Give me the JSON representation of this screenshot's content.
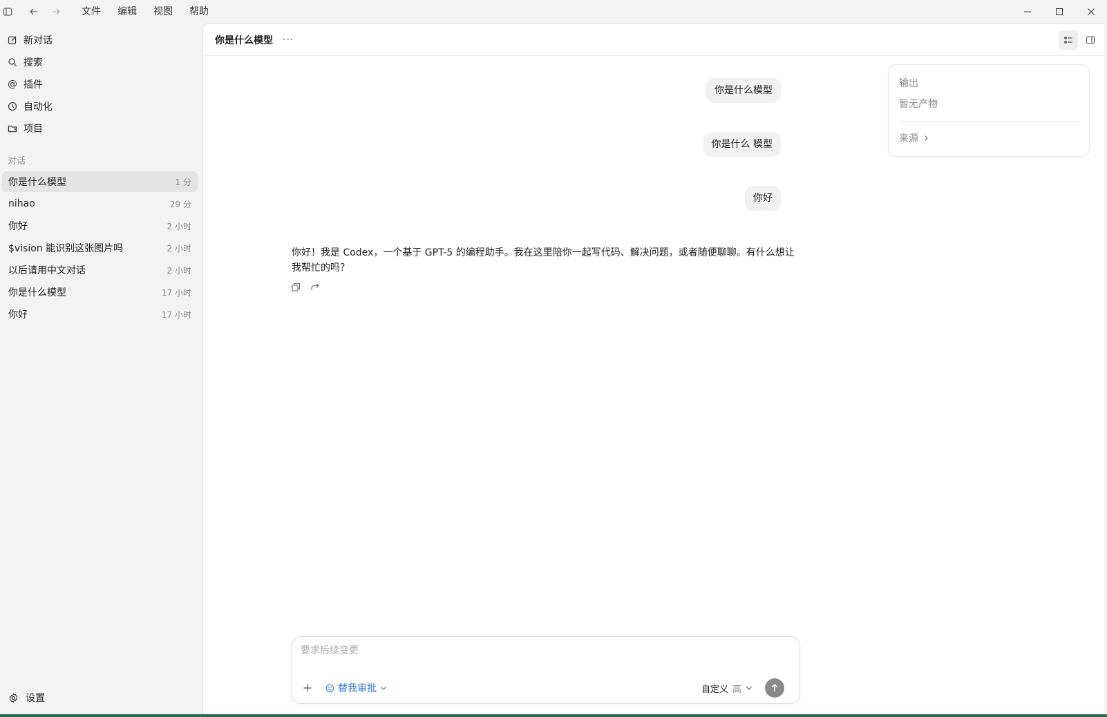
{
  "menu": [
    "文件",
    "编辑",
    "视图",
    "帮助"
  ],
  "sidebar": {
    "nav": [
      {
        "label": "新对话",
        "icon": "compose-icon"
      },
      {
        "label": "搜索",
        "icon": "search-icon"
      },
      {
        "label": "插件",
        "icon": "at-icon"
      },
      {
        "label": "自动化",
        "icon": "clock-icon"
      },
      {
        "label": "项目",
        "icon": "folder-icon"
      }
    ],
    "section_label": "对话",
    "conversations": [
      {
        "title": "你是什么模型",
        "time": "1 分",
        "active": true
      },
      {
        "title": "nihao",
        "time": "29 分"
      },
      {
        "title": "你好",
        "time": "2 小时"
      },
      {
        "title": "$vision 能识别这张图片吗",
        "time": "2 小时"
      },
      {
        "title": "以后请用中文对话",
        "time": "2 小时"
      },
      {
        "title": "你是什么模型",
        "time": "17 小时"
      },
      {
        "title": "你好",
        "time": "17 小时"
      }
    ],
    "settings_label": "设置"
  },
  "header": {
    "title": "你是什么模型",
    "more": "···"
  },
  "messages": {
    "user": [
      "你是什么模型",
      "你是什么 模型",
      "你好"
    ],
    "assistant": "你好！我是 Codex，一个基于 GPT-5 的编程助手。我在这里陪你一起写代码、解决问题，或者随便聊聊。有什么想让我帮忙的吗？"
  },
  "output_panel": {
    "title": "输出",
    "empty": "暂无产物",
    "source": "来源"
  },
  "composer": {
    "placeholder": "要求后续变更",
    "approve_label": "替我审批",
    "custom_label": "自定义",
    "level_label": "高"
  },
  "colors": {
    "accent": "#2f7be5",
    "sidebar_bg": "#f3f3f3",
    "bubble_bg": "#f1f1f1"
  }
}
